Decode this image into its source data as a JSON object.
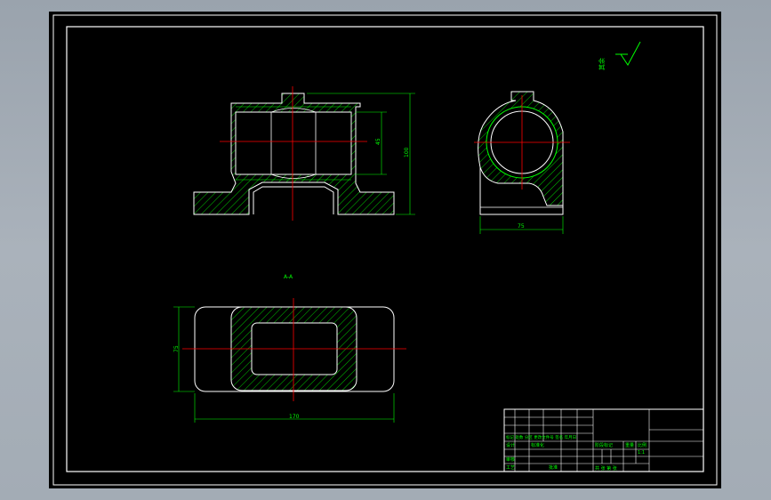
{
  "drawing": {
    "dimensions": {
      "front_inner_height": "45",
      "front_total_height": "100",
      "side_width": "75",
      "plan_height": "75",
      "plan_width": "170"
    },
    "section_label": "A-A",
    "roughness_note": "其余",
    "title_block": {
      "row_left_1": "标记 处数 分区 更改文件号 签名 年月日",
      "designer": "设计",
      "standard": "标准化",
      "stage_mark": "阶段标记",
      "weight": "重量",
      "scale": "比例",
      "scale_value": "1:1",
      "checker": "审核",
      "process": "工艺",
      "approve": "批准",
      "sheet": "共 张 第 张"
    }
  },
  "colors": {
    "background": "#000000",
    "outline": "#ffffff",
    "dimension": "#00ff00",
    "centerline": "#ff0000",
    "hatch": "#00ff00",
    "frame": "#ffffff"
  }
}
